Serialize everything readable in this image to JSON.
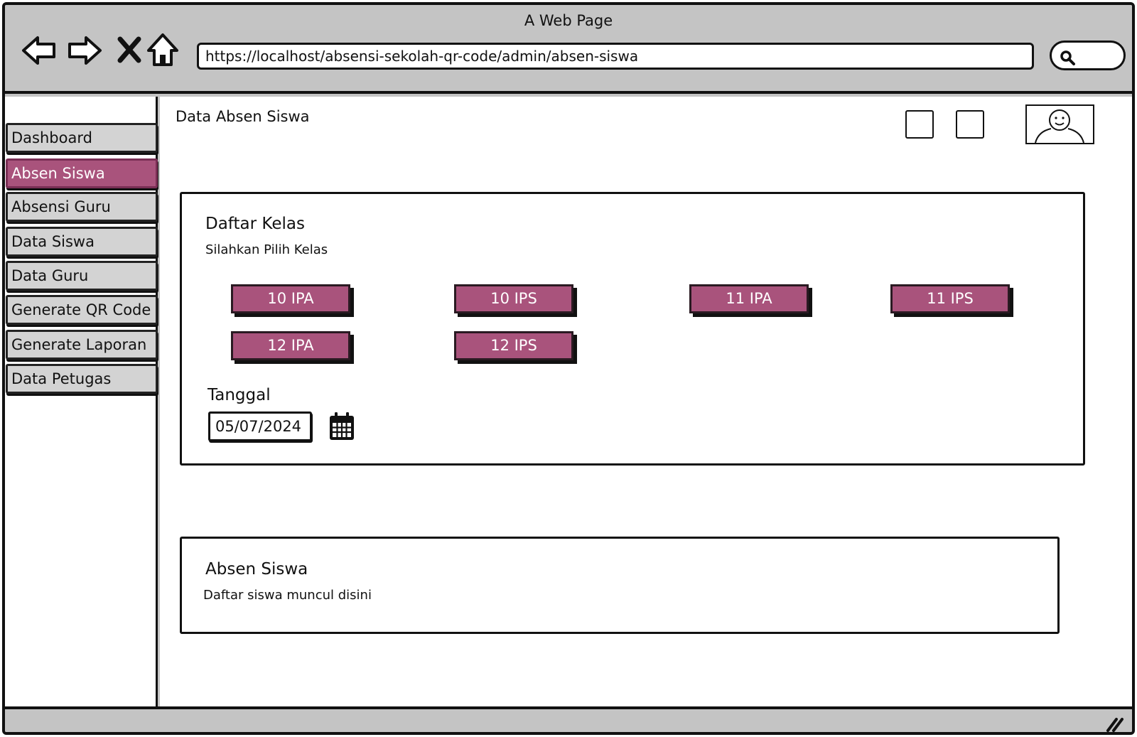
{
  "window": {
    "title": "A Web Page",
    "url": "https://localhost/absensi-sekolah-qr-code/admin/absen-siswa"
  },
  "toolbar_icons": [
    "back-arrow-icon",
    "forward-arrow-icon",
    "close-x-icon",
    "home-icon",
    "search-icon"
  ],
  "sidebar": {
    "items": [
      {
        "label": "Dashboard",
        "active": false
      },
      {
        "label": "Absen Siswa",
        "active": true
      },
      {
        "label": "Absensi Guru",
        "active": false
      },
      {
        "label": "Data Siswa",
        "active": false
      },
      {
        "label": "Data Guru",
        "active": false
      },
      {
        "label": "Generate QR Code",
        "active": false
      },
      {
        "label": "Generate Laporan",
        "active": false
      },
      {
        "label": "Data Petugas",
        "active": false
      }
    ]
  },
  "header": {
    "title": "Data Absen Siswa",
    "icons": [
      "notification-placeholder-icon",
      "settings-placeholder-icon",
      "user-avatar-icon"
    ]
  },
  "class_card": {
    "title": "Daftar Kelas",
    "subtitle": "Silahkan Pilih Kelas",
    "classes": [
      "10 IPA",
      "10 IPS",
      "11 IPA",
      "11 IPS",
      "12 IPA",
      "12 IPS"
    ],
    "date_label": "Tanggal",
    "date_value": "05/07/2024"
  },
  "attendance_card": {
    "title": "Absen Siswa",
    "subtitle": "Daftar siswa muncul disini"
  },
  "colors": {
    "accent": "#a9537c",
    "chrome": "#c4c4c4",
    "menu_item": "#d3d3d3",
    "outline": "#111111"
  }
}
